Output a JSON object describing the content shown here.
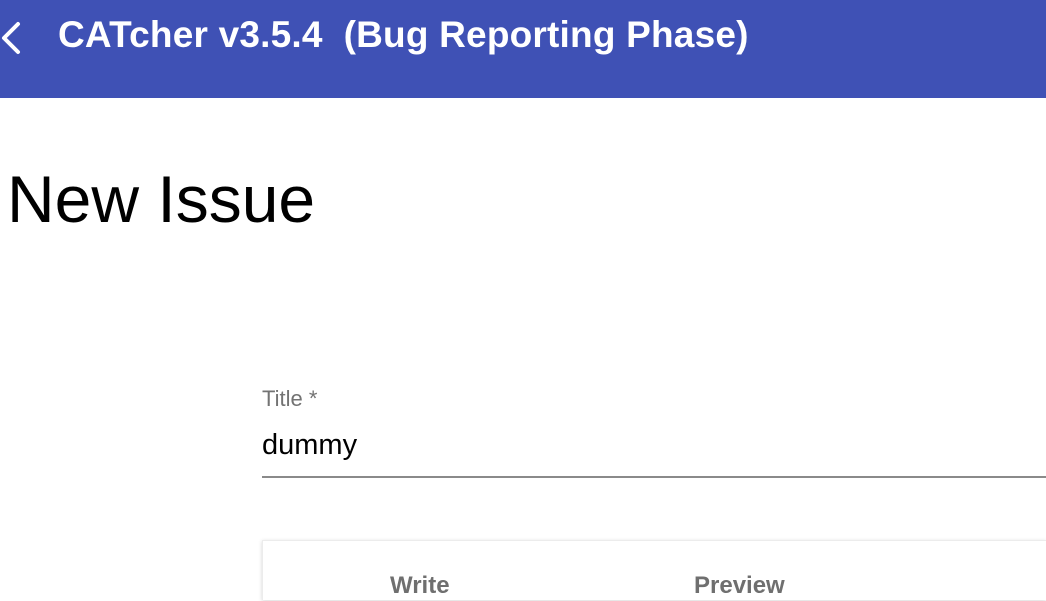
{
  "toolbar": {
    "back_icon": "chevron-left-icon",
    "title": "CATcher v3.5.4  (Bug Reporting Phase)",
    "background_color": "#3f51b5"
  },
  "page": {
    "title": "New Issue"
  },
  "form": {
    "title_field": {
      "label": "Title *",
      "value": "dummy"
    },
    "editor_tabs": [
      {
        "label": "Write"
      },
      {
        "label": "Preview"
      }
    ]
  }
}
